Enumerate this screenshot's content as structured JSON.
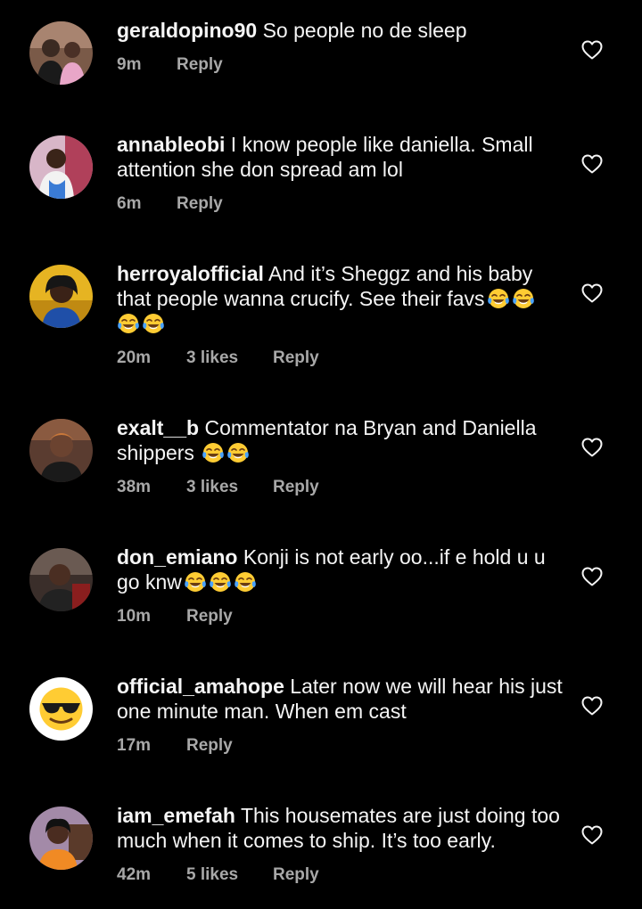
{
  "comments": [
    {
      "username": "geraldopino90",
      "text": "So people no de sleep",
      "emoji_count": 0,
      "time": "9m",
      "likes": "",
      "reply_label": "Reply",
      "avatar_icon": "profile-photo-couple",
      "avatar_color": "#5b3a29"
    },
    {
      "username": "annableobi",
      "text": "I know people like daniella. Small attention she don spread am lol",
      "emoji_count": 0,
      "time": "6m",
      "likes": "",
      "reply_label": "Reply",
      "avatar_icon": "profile-photo-woman",
      "avatar_color": "#c7a0b8"
    },
    {
      "username": "herroyalofficial",
      "text": "And it’s Sheggz and his baby that people wanna crucify. See their favs",
      "emoji_count": 4,
      "emoji_icon": "face-with-tears-of-joy",
      "time": "20m",
      "likes": "3 likes",
      "reply_label": "Reply",
      "avatar_icon": "profile-photo-woman",
      "avatar_color": "#d4a017"
    },
    {
      "username": "exalt__b",
      "text": "Commentator na Bryan and Daniella shippers",
      "emoji_count": 2,
      "emoji_icon": "face-with-tears-of-joy",
      "time": "38m",
      "likes": "3 likes",
      "reply_label": "Reply",
      "avatar_icon": "profile-photo-woman",
      "avatar_color": "#6b4b3a"
    },
    {
      "username": "don_emiano",
      "text": "Konji is not early oo...if e hold u u go knw",
      "emoji_count": 3,
      "emoji_icon": "face-with-tears-of-joy",
      "time": "10m",
      "likes": "",
      "reply_label": "Reply",
      "avatar_icon": "profile-photo-man",
      "avatar_color": "#4a3a32"
    },
    {
      "username": "official_amahope",
      "text": "Later now we will hear his just one minute man. When em cast",
      "emoji_count": 0,
      "time": "17m",
      "likes": "",
      "reply_label": "Reply",
      "avatar_icon": "smiling-face-with-sunglasses",
      "avatar_color": "#ffffff"
    },
    {
      "username": "iam_emefah",
      "text": "This housemates are just doing too much when it comes to ship. It’s too early.",
      "emoji_count": 0,
      "time": "42m",
      "likes": "5 likes",
      "reply_label": "Reply",
      "avatar_icon": "profile-photo-woman",
      "avatar_color": "#9c7a9a"
    }
  ],
  "like_icon": "heart-outline-icon",
  "colors": {
    "background": "#000000",
    "primary_text": "#f5f5f5",
    "secondary_text": "#a8a8a8"
  }
}
